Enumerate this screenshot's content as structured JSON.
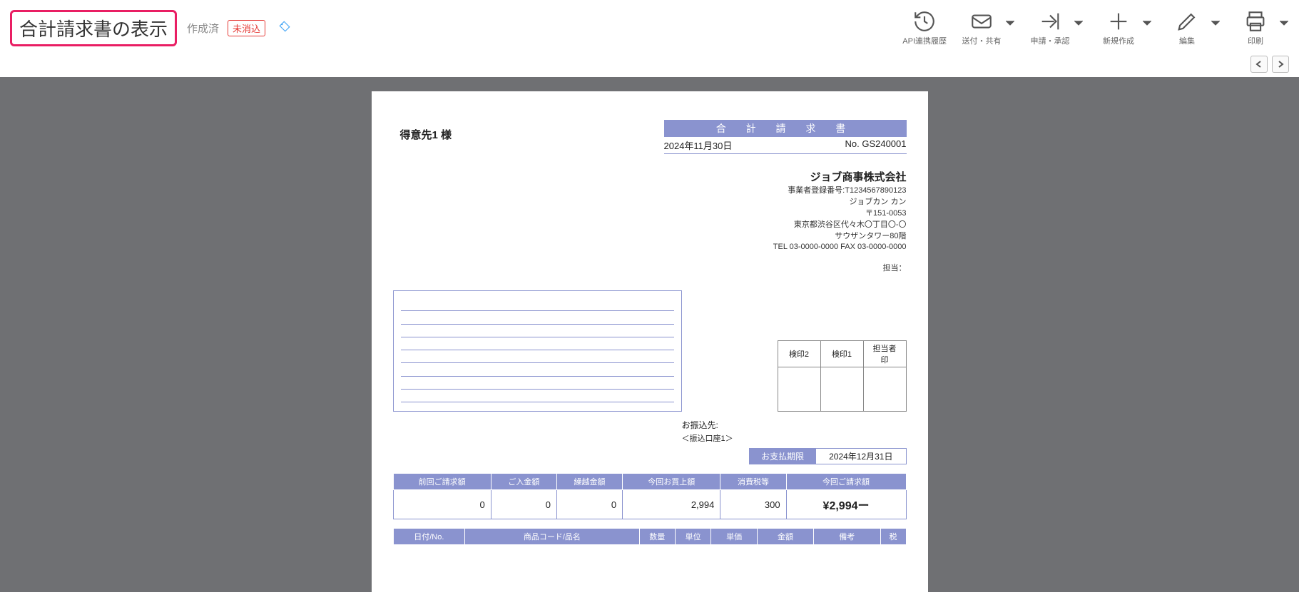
{
  "toolbar": {
    "title": "合計請求書の表示",
    "status_done": "作成済",
    "status_badge": "未消込",
    "buttons": {
      "api": "API連携履歴",
      "send": "送付・共有",
      "apply": "申請・承認",
      "new": "新規作成",
      "edit": "編集",
      "print": "印刷"
    }
  },
  "doc": {
    "customer": "得意先1 様",
    "title": "合 計 請 求 書",
    "date": "2024年11月30日",
    "no_label": "No.",
    "no": "GS240001",
    "company": {
      "name": "ジョブ商事株式会社",
      "reg": "事業者登録番号:T1234567890123",
      "kana": "ジョブカン カン",
      "zip": "〒151-0053",
      "addr": "東京都渋谷区代々木〇丁目〇-〇",
      "bldg": "サウザンタワー80階",
      "tel": "TEL 03-0000-0000 FAX 03-0000-0000",
      "tanto_label": "担当："
    },
    "stamps": {
      "h1": "検印2",
      "h2": "検印1",
      "h3": "担当者印"
    },
    "transfer": {
      "label": "お振込先:",
      "acct": "＜振込口座1＞"
    },
    "due": {
      "label": "お支払期限",
      "value": "2024年12月31日"
    },
    "summary": {
      "headers": {
        "prev": "前回ご請求額",
        "paid": "ご入金額",
        "carry": "繰越金額",
        "purchase": "今回お買上額",
        "tax": "消費税等",
        "total": "今回ご請求額"
      },
      "values": {
        "prev": "0",
        "paid": "0",
        "carry": "0",
        "purchase": "2,994",
        "tax": "300",
        "total": "¥2,994ー"
      }
    },
    "detail_headers": {
      "date": "日付/No.",
      "item": "商品コード/品名",
      "qty": "数量",
      "unit": "単位",
      "price": "単価",
      "amount": "金額",
      "note": "備考",
      "tax": "税"
    }
  }
}
